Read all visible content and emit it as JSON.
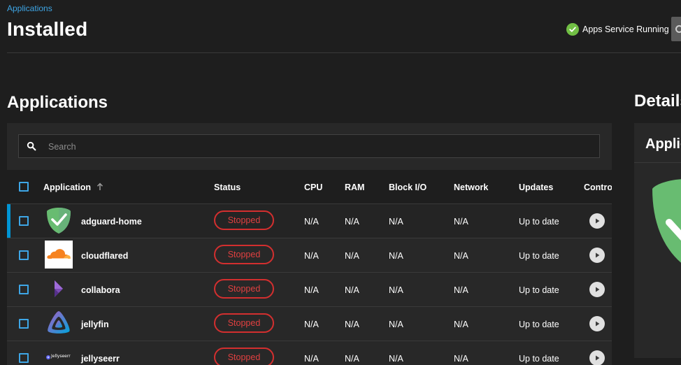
{
  "breadcrumb": "Applications",
  "page_title": "Installed",
  "service_status": "Apps Service Running",
  "sections": {
    "applications": "Applications",
    "details": "Details"
  },
  "details_card_title": "Applications",
  "search": {
    "placeholder": "Search",
    "value": ""
  },
  "table": {
    "headers": {
      "application": "Application",
      "status": "Status",
      "cpu": "CPU",
      "ram": "RAM",
      "block_io": "Block I/O",
      "network": "Network",
      "updates": "Updates",
      "controls": "Controls"
    },
    "rows": [
      {
        "name": "adguard-home",
        "status": "Stopped",
        "cpu": "N/A",
        "ram": "N/A",
        "block_io": "N/A",
        "network": "N/A",
        "updates": "Up to date"
      },
      {
        "name": "cloudflared",
        "status": "Stopped",
        "cpu": "N/A",
        "ram": "N/A",
        "block_io": "N/A",
        "network": "N/A",
        "updates": "Up to date"
      },
      {
        "name": "collabora",
        "status": "Stopped",
        "cpu": "N/A",
        "ram": "N/A",
        "block_io": "N/A",
        "network": "N/A",
        "updates": "Up to date"
      },
      {
        "name": "jellyfin",
        "status": "Stopped",
        "cpu": "N/A",
        "ram": "N/A",
        "block_io": "N/A",
        "network": "N/A",
        "updates": "Up to date"
      },
      {
        "name": "jellyseerr",
        "status": "Stopped",
        "cpu": "N/A",
        "ram": "N/A",
        "block_io": "N/A",
        "network": "N/A",
        "updates": "Up to date"
      }
    ]
  },
  "jellyseerr_logo_text": "Jellyseerr",
  "icons": {
    "status_check": "check-circle-icon",
    "search": "magnify-icon",
    "sort": "arrow-up-icon",
    "play": "play-icon"
  },
  "colors": {
    "accent": "#0095d5",
    "link": "#3ea6e6",
    "stopped": "#d32f2f",
    "running": "#71bf44",
    "background": "#1e1e1e",
    "card": "#282828"
  }
}
